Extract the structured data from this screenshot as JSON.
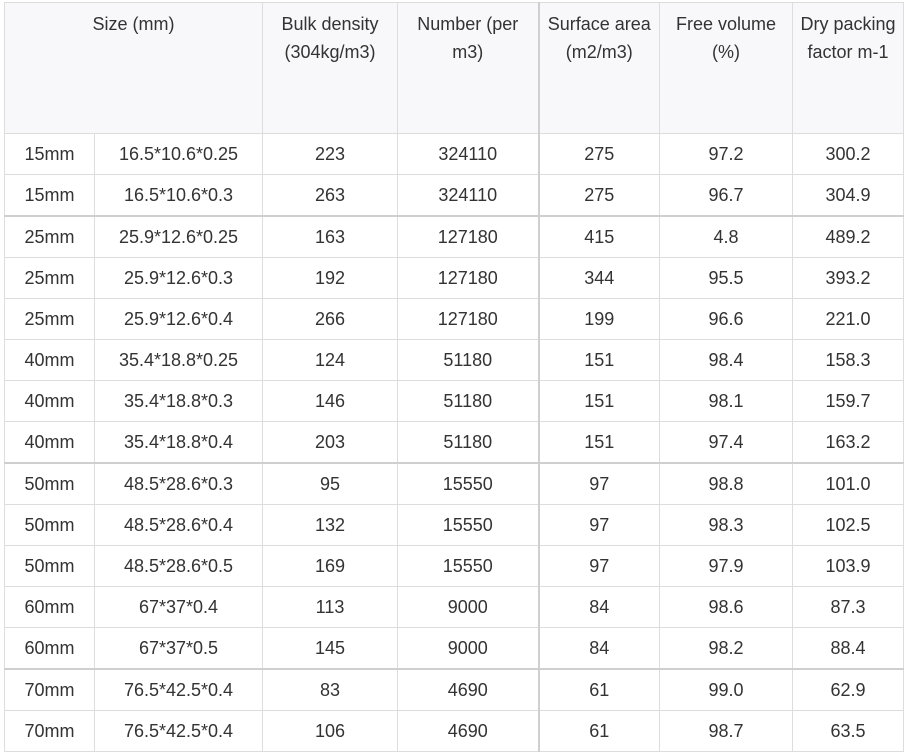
{
  "table": {
    "headers": {
      "size": "Size (mm)",
      "bulk_density": "Bulk density (304kg/m3)",
      "number": "Number (per m3)",
      "surface_area": "Surface area (m2/m3)",
      "free_volume": "Free volume (%)",
      "dry_packing": "Dry packing factor m-1"
    },
    "rows": [
      {
        "nominal": "15mm",
        "dims": "16.5*10.6*0.25",
        "bulk": "223",
        "number": "324110",
        "surface": "275",
        "free": "97.2",
        "dry": "300.2"
      },
      {
        "nominal": "15mm",
        "dims": "16.5*10.6*0.3",
        "bulk": "263",
        "number": "324110",
        "surface": "275",
        "free": "96.7",
        "dry": "304.9"
      },
      {
        "nominal": "25mm",
        "dims": "25.9*12.6*0.25",
        "bulk": "163",
        "number": "127180",
        "surface": "415",
        "free": "4.8",
        "dry": "489.2"
      },
      {
        "nominal": "25mm",
        "dims": "25.9*12.6*0.3",
        "bulk": "192",
        "number": "127180",
        "surface": "344",
        "free": "95.5",
        "dry": "393.2"
      },
      {
        "nominal": "25mm",
        "dims": "25.9*12.6*0.4",
        "bulk": "266",
        "number": "127180",
        "surface": "199",
        "free": "96.6",
        "dry": "221.0"
      },
      {
        "nominal": "40mm",
        "dims": "35.4*18.8*0.25",
        "bulk": "124",
        "number": "51180",
        "surface": "151",
        "free": "98.4",
        "dry": "158.3"
      },
      {
        "nominal": "40mm",
        "dims": "35.4*18.8*0.3",
        "bulk": "146",
        "number": "51180",
        "surface": "151",
        "free": "98.1",
        "dry": "159.7"
      },
      {
        "nominal": "40mm",
        "dims": "35.4*18.8*0.4",
        "bulk": "203",
        "number": "51180",
        "surface": "151",
        "free": "97.4",
        "dry": "163.2"
      },
      {
        "nominal": "50mm",
        "dims": "48.5*28.6*0.3",
        "bulk": "95",
        "number": "15550",
        "surface": "97",
        "free": "98.8",
        "dry": "101.0"
      },
      {
        "nominal": "50mm",
        "dims": "48.5*28.6*0.4",
        "bulk": "132",
        "number": "15550",
        "surface": "97",
        "free": "98.3",
        "dry": "102.5"
      },
      {
        "nominal": "50mm",
        "dims": "48.5*28.6*0.5",
        "bulk": "169",
        "number": "15550",
        "surface": "97",
        "free": "97.9",
        "dry": "103.9"
      },
      {
        "nominal": "60mm",
        "dims": "67*37*0.4",
        "bulk": "113",
        "number": "9000",
        "surface": "84",
        "free": "98.6",
        "dry": "87.3"
      },
      {
        "nominal": "60mm",
        "dims": "67*37*0.5",
        "bulk": "145",
        "number": "9000",
        "surface": "84",
        "free": "98.2",
        "dry": "88.4"
      },
      {
        "nominal": "70mm",
        "dims": "76.5*42.5*0.4",
        "bulk": "83",
        "number": "4690",
        "surface": "61",
        "free": "99.0",
        "dry": "62.9"
      },
      {
        "nominal": "70mm",
        "dims": "76.5*42.5*0.4",
        "bulk": "106",
        "number": "4690",
        "surface": "61",
        "free": "98.7",
        "dry": "63.5"
      }
    ]
  }
}
